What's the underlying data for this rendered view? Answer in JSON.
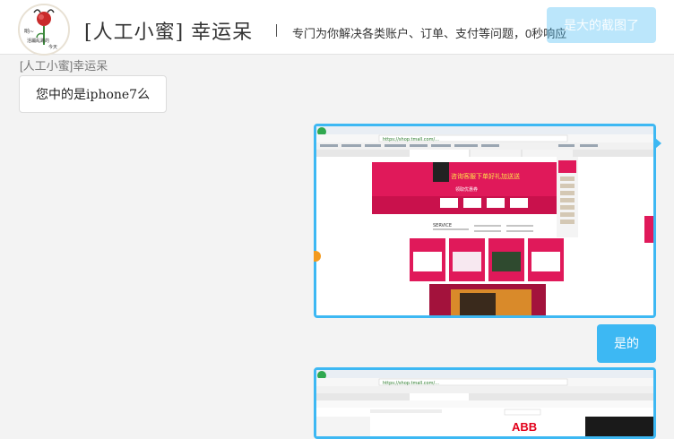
{
  "header": {
    "title": "[人工小蜜] 幸运呆",
    "tagline": "专门为你解决各类账户、订单、支付等问题，0秒响应",
    "ghost_message": "是大的截图了"
  },
  "avatar": {
    "text_line1": "哟~",
    "text_line2": "活蹦乱跳的",
    "text_line3": "今天"
  },
  "chat": {
    "sender_name": "[人工小蜜]幸运呆",
    "messages": [
      {
        "from": "agent",
        "text": "您中的是iphone7么"
      },
      {
        "from": "user",
        "type": "image"
      },
      {
        "from": "user",
        "text": "是的"
      },
      {
        "from": "user",
        "type": "image"
      }
    ]
  },
  "screenshot1": {
    "browser_url": "https://shop.tmall.com/...",
    "banner_text": "咨询客服下单好礼加送送",
    "coupon_title": "领取优惠券",
    "service_label": "SERVICE"
  },
  "screenshot2": {
    "browser_url": "https://shop.tmall.com/...",
    "brand": "ABB"
  },
  "colors": {
    "accent": "#3db8f3",
    "header_bg": "#ffffff",
    "chat_bg": "#f3f3f3",
    "tmall_pink": "#e0195a",
    "tmall_dark": "#a3123c"
  }
}
